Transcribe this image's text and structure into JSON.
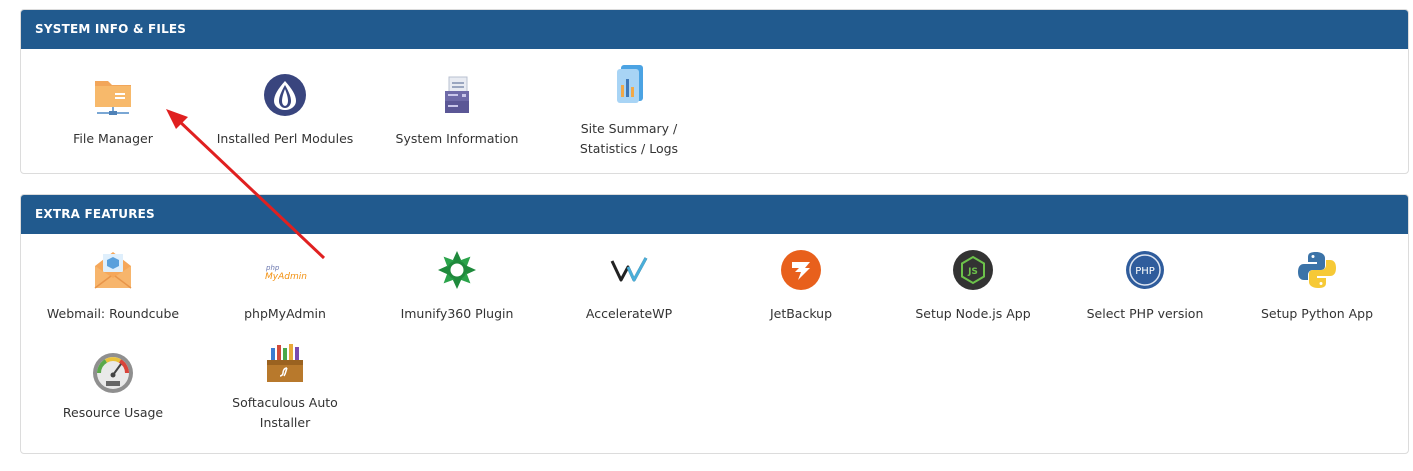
{
  "sections": [
    {
      "title": "SYSTEM INFO & FILES",
      "items": [
        {
          "label": "File Manager",
          "icon": "folder-network-icon"
        },
        {
          "label": "Installed Perl Modules",
          "icon": "perl-onion-icon"
        },
        {
          "label": "System Information",
          "icon": "server-document-icon"
        },
        {
          "label": "Site Summary / Statistics / Logs",
          "icon": "statistics-report-icon"
        }
      ]
    },
    {
      "title": "EXTRA FEATURES",
      "items": [
        {
          "label": "Webmail: Roundcube",
          "icon": "roundcube-envelope-icon"
        },
        {
          "label": "phpMyAdmin",
          "icon": "phpmyadmin-logo-icon",
          "logo_small": "php",
          "logo_big": "MyAdmin"
        },
        {
          "label": "Imunify360 Plugin",
          "icon": "imunify360-icon"
        },
        {
          "label": "AccelerateWP",
          "icon": "acceleratewp-icon"
        },
        {
          "label": "JetBackup",
          "icon": "jetbackup-icon"
        },
        {
          "label": "Setup Node.js App",
          "icon": "nodejs-icon",
          "logo_text": "JS"
        },
        {
          "label": "Select PHP version",
          "icon": "php-icon",
          "logo_text": "PHP"
        },
        {
          "label": "Setup Python App",
          "icon": "python-icon"
        },
        {
          "label": "Resource Usage",
          "icon": "gauge-meter-icon"
        },
        {
          "label": "Softaculous Auto Installer",
          "icon": "softaculous-toolbox-icon"
        }
      ]
    }
  ],
  "colors": {
    "header_bg": "#215a8e",
    "annotation_arrow": "#e02020"
  }
}
